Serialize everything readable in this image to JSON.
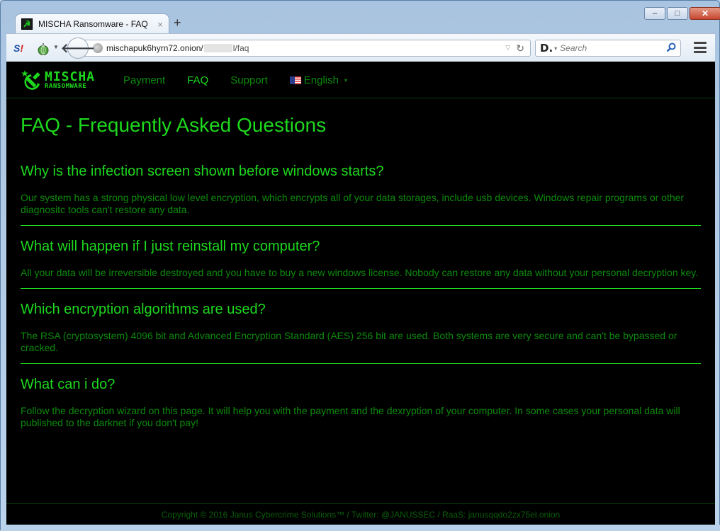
{
  "browser": {
    "tab": {
      "title": "MISCHA Ransomware - FAQ",
      "favicon": "hammer-sickle-icon",
      "close": "×"
    },
    "new_tab": "+",
    "window_controls": {
      "minimize": "–",
      "maximize": "□",
      "close": "✕"
    },
    "toolbar": {
      "s_icon_text": "S",
      "s_icon_bang": "!",
      "back": "🡐",
      "url_host": "mischapuk6hyrn72.onion/",
      "url_path": "l/faq",
      "url_dropdown": "▽",
      "reload": "↻",
      "search_engine_logo": "D.",
      "search_engine_dropdown": "▾",
      "search_placeholder": "Search",
      "search_icon": "⚲"
    }
  },
  "site": {
    "logo": {
      "main": "MISCHA",
      "sub": "RANSOMWARE"
    },
    "nav": [
      {
        "label": "Payment",
        "active": false
      },
      {
        "label": "FAQ",
        "active": true
      },
      {
        "label": "Support",
        "active": false
      },
      {
        "label": "English",
        "active": false,
        "dropdown": "▾"
      }
    ],
    "page_title": "FAQ - Frequently Asked Questions",
    "faq": [
      {
        "question": "Why is the infection screen shown before windows starts?",
        "answer": "Our system has a strong physical low level encryption, which encrypts all of your data storages, include usb devices. Windows repair programs or other diagnositc tools can't restore any data."
      },
      {
        "question": "What will happen if I just reinstall my computer?",
        "answer": "All your data will be irreversible destroyed and you have to buy a new windows license. Nobody can restore any data without your personal decryption key."
      },
      {
        "question": "Which encryption algorithms are used?",
        "answer": "The RSA (cryptosystem) 4096 bit and Advanced Encryption Standard (AES) 256 bit are used. Both systems are very secure and can't be bypassed or cracked."
      },
      {
        "question": "What can i do?",
        "answer": "Follow the decryption wizard on this page. It will help you with the payment and the dexryption of your computer. In some cases your personal data will published to the darknet if you don't pay!"
      }
    ],
    "footer": "Copyright © 2016 Janus Cybercrime Solutions™ / Twitter: @JANUSSEC / RaaS: janusqqdo2zx75el.onion"
  },
  "colors": {
    "accent": "#1ed81e",
    "body_text": "#0d8a0d",
    "footer_text": "#0b5e0b",
    "background": "#000000"
  }
}
